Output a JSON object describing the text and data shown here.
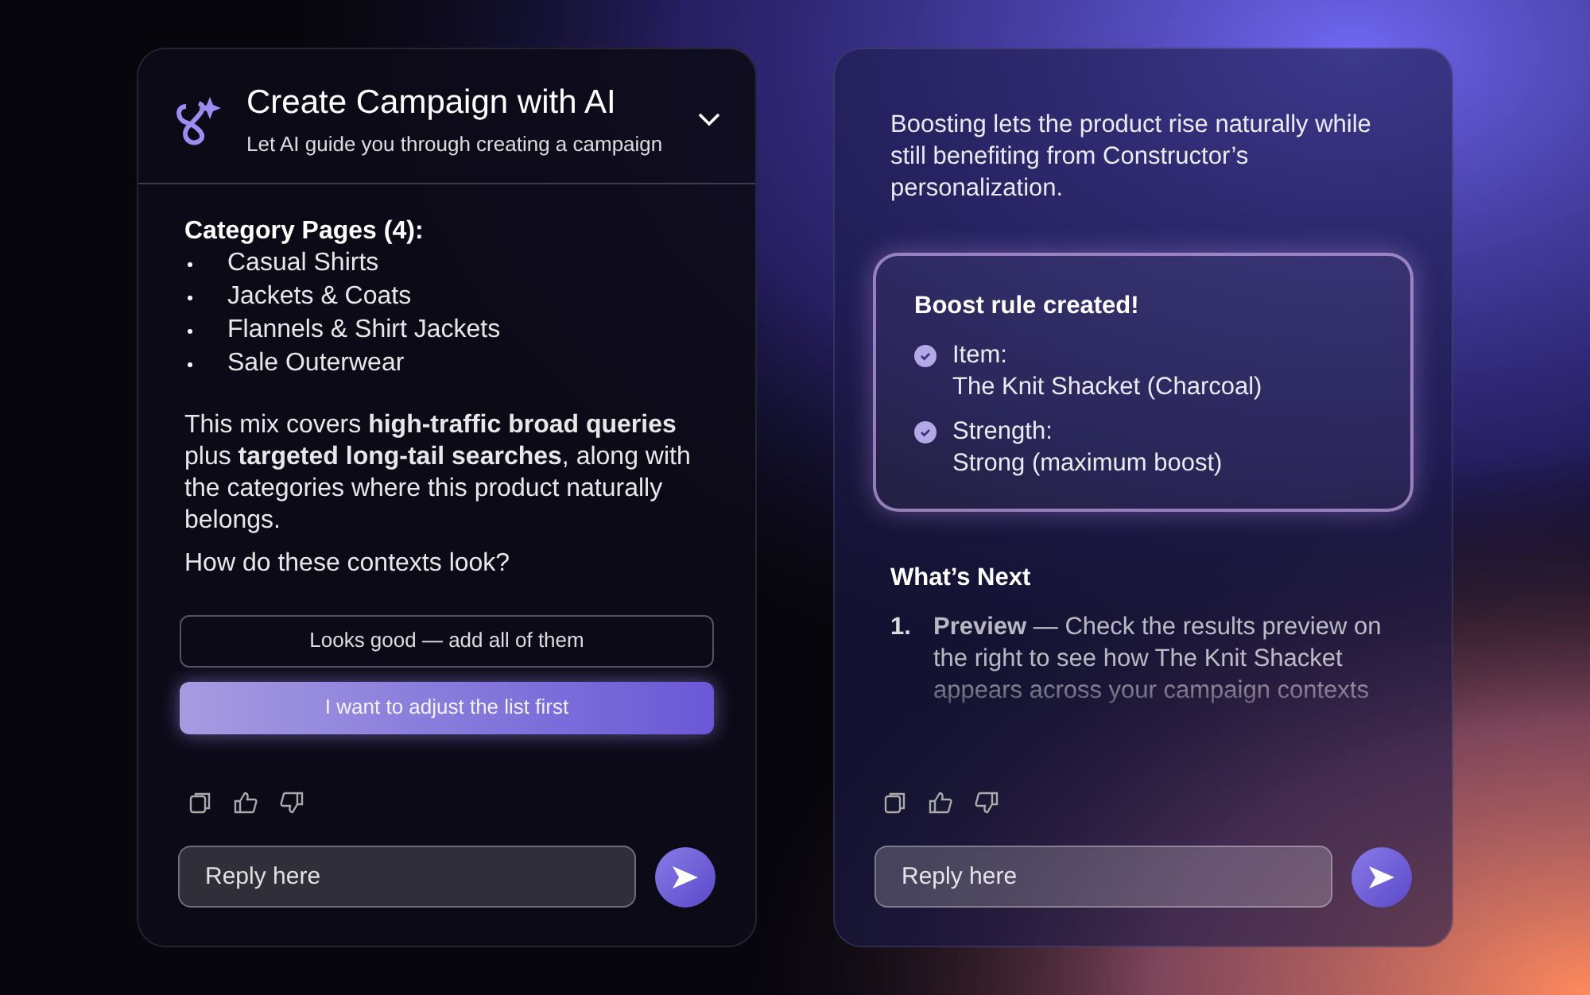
{
  "left_panel": {
    "header": {
      "title": "Create Campaign with AI",
      "subtitle": "Let AI guide you through creating a campaign"
    },
    "category_heading": "Category Pages (4):",
    "categories": [
      "Casual Shirts",
      "Jackets & Coats",
      "Flannels & Shirt Jackets",
      "Sale Outerwear"
    ],
    "summary": "This mix covers **high-traffic broad queries** plus **targeted long-tail searches**, along with the categories where this product naturally belongs.",
    "question": "How do these contexts look?",
    "options": [
      {
        "label": "Looks good — add all of them",
        "selected": false
      },
      {
        "label": "I want to adjust the list first",
        "selected": true
      }
    ],
    "reply": {
      "placeholder": "Reply here"
    }
  },
  "right_panel": {
    "intro": "Boosting lets the product rise naturally while still benefiting from Constructor’s personalization.",
    "rule_card": {
      "title": "Boost rule created!",
      "items": [
        {
          "label": "Item:",
          "value": "The Knit Shacket (Charcoal)"
        },
        {
          "label": "Strength:",
          "value": "Strong (maximum boost)"
        }
      ]
    },
    "next_heading": "What’s Next",
    "steps": [
      {
        "number": "1.",
        "text": "**Preview** — Check the results preview on the right to see how The Knit Shacket appears across your campaign contexts"
      }
    ],
    "reply": {
      "placeholder": "Reply here"
    }
  }
}
